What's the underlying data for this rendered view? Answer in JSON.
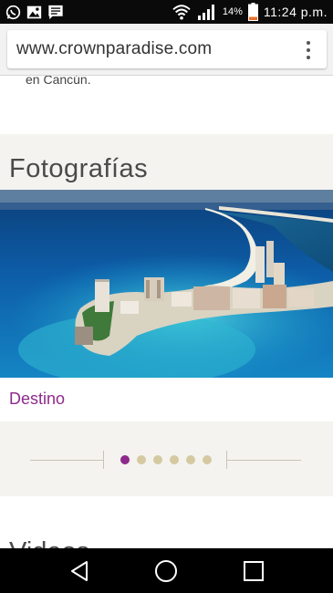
{
  "status_bar": {
    "battery_percent": "14%",
    "time": "11:24 p.m.",
    "icons": [
      "whatsapp-icon",
      "gallery-icon",
      "message-icon",
      "wifi-icon",
      "signal-icon",
      "battery-icon"
    ]
  },
  "browser": {
    "url": "www.crownparadise.com",
    "menu_icon": "more-vert-icon"
  },
  "page": {
    "cut_text": "en Cancún.",
    "photos_section": {
      "title": "Fotografías",
      "slide_caption": "Destino",
      "slide_count": 6,
      "active_slide": 1
    },
    "next_section_title": "Videos"
  },
  "colors": {
    "accent": "#8e2a8b",
    "dot_inactive": "#d5c9a2",
    "section_bg": "#f4f3ef"
  },
  "nav_bar": {
    "icons": [
      "back-icon",
      "home-icon",
      "recents-icon"
    ]
  }
}
